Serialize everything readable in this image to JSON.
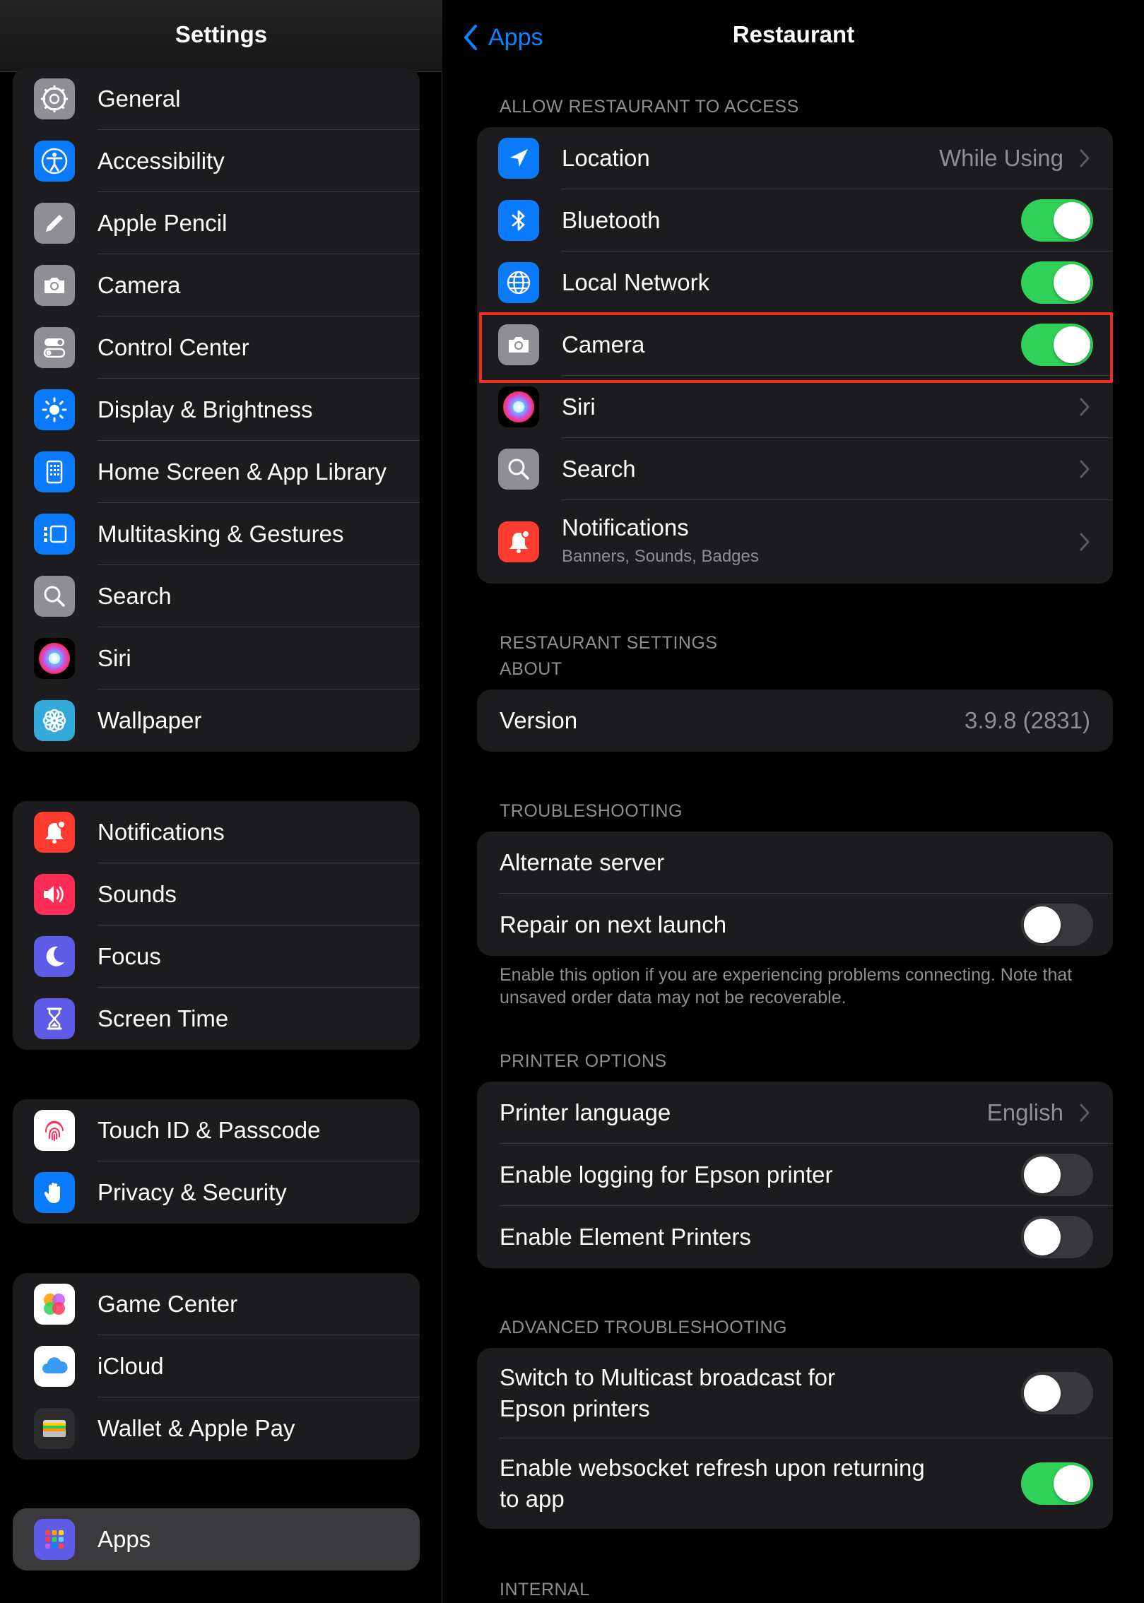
{
  "sidebar": {
    "title": "Settings",
    "group1": [
      {
        "label": "General",
        "icon": "gear-icon",
        "color": "#8e8e93"
      },
      {
        "label": "Accessibility",
        "icon": "accessibility-icon",
        "color": "#0a7aff"
      },
      {
        "label": "Apple Pencil",
        "icon": "pencil-icon",
        "color": "#8e8e93"
      },
      {
        "label": "Camera",
        "icon": "camera-icon",
        "color": "#8e8e93"
      },
      {
        "label": "Control Center",
        "icon": "switches-icon",
        "color": "#8e8e93"
      },
      {
        "label": "Display & Brightness",
        "icon": "sun-icon",
        "color": "#0a7aff"
      },
      {
        "label": "Home Screen & App Library",
        "icon": "home-grid-icon",
        "color": "#0a7aff"
      },
      {
        "label": "Multitasking & Gestures",
        "icon": "multitasking-icon",
        "color": "#0a7aff"
      },
      {
        "label": "Search",
        "icon": "search-icon",
        "color": "#8e8e93"
      },
      {
        "label": "Siri",
        "icon": "siri-icon",
        "color": "#000000"
      },
      {
        "label": "Wallpaper",
        "icon": "flower-icon",
        "color": "#34aadc"
      }
    ],
    "group2": [
      {
        "label": "Notifications",
        "icon": "bell-icon",
        "color": "#ff3b30"
      },
      {
        "label": "Sounds",
        "icon": "speaker-icon",
        "color": "#ff2d55"
      },
      {
        "label": "Focus",
        "icon": "moon-icon",
        "color": "#5e5ce6"
      },
      {
        "label": "Screen Time",
        "icon": "hourglass-icon",
        "color": "#5e5ce6"
      }
    ],
    "group3": [
      {
        "label": "Touch ID & Passcode",
        "icon": "fingerprint-icon",
        "color": "#ffffff"
      },
      {
        "label": "Privacy & Security",
        "icon": "hand-icon",
        "color": "#0a7aff"
      }
    ],
    "group4": [
      {
        "label": "Game Center",
        "icon": "game-center-icon",
        "color": "#ffffff"
      },
      {
        "label": "iCloud",
        "icon": "cloud-icon",
        "color": "#ffffff"
      },
      {
        "label": "Wallet & Apple Pay",
        "icon": "wallet-icon",
        "color": "#1c1c1e"
      }
    ],
    "group5": [
      {
        "label": "Apps",
        "icon": "apps-grid-icon",
        "color": "#5e5ce6",
        "selected": true
      }
    ]
  },
  "detail": {
    "back_label": "Apps",
    "title": "Restaurant",
    "access_header": "ALLOW RESTAURANT TO ACCESS",
    "access": {
      "location": {
        "label": "Location",
        "value": "While Using"
      },
      "bluetooth": {
        "label": "Bluetooth",
        "on": true
      },
      "local_network": {
        "label": "Local Network",
        "on": true
      },
      "camera": {
        "label": "Camera",
        "on": true
      },
      "siri": {
        "label": "Siri"
      },
      "search": {
        "label": "Search"
      },
      "notifications": {
        "label": "Notifications",
        "sublabel": "Banners, Sounds, Badges"
      }
    },
    "settings_header": "RESTAURANT SETTINGS",
    "about_header": "ABOUT",
    "version": {
      "label": "Version",
      "value": "3.9.8 (2831)"
    },
    "troubleshooting_header": "TROUBLESHOOTING",
    "alternate_server": {
      "label": "Alternate server"
    },
    "repair": {
      "label": "Repair on next launch",
      "on": false
    },
    "troubleshooting_footnote": "Enable this option if you are experiencing problems connecting. Note that unsaved order data may not be recoverable.",
    "printer_header": "PRINTER OPTIONS",
    "printer_language": {
      "label": "Printer language",
      "value": "English"
    },
    "epson_logging": {
      "label": "Enable logging for Epson printer",
      "on": false
    },
    "element_printers": {
      "label": "Enable Element Printers",
      "on": false
    },
    "advanced_header": "ADVANCED TROUBLESHOOTING",
    "multicast": {
      "label_line1": "Switch to Multicast broadcast for",
      "label_line2": "Epson printers",
      "on": false
    },
    "websocket": {
      "label_line1": "Enable websocket refresh upon returning",
      "label_line2": "to app",
      "on": true
    },
    "internal_header": "INTERNAL"
  },
  "colors": {
    "accent": "#0a84ff",
    "toggle_on": "#30d158",
    "highlight": "#e8301f"
  }
}
